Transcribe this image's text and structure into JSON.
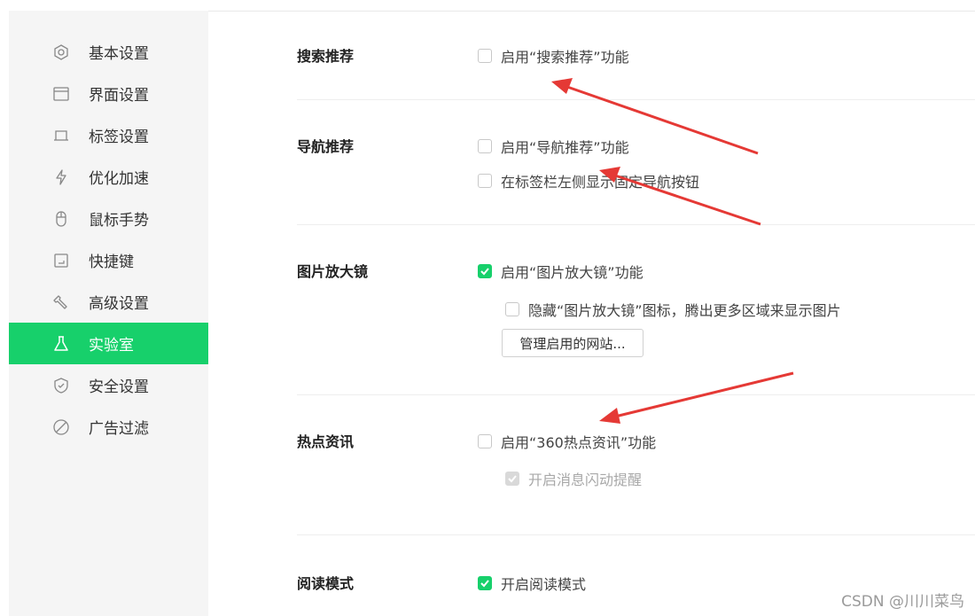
{
  "sidebar": {
    "items": [
      {
        "label": "基本设置",
        "icon": "hexagon-settings-icon",
        "active": false
      },
      {
        "label": "界面设置",
        "icon": "window-icon",
        "active": false
      },
      {
        "label": "标签设置",
        "icon": "tab-icon",
        "active": false
      },
      {
        "label": "优化加速",
        "icon": "lightning-icon",
        "active": false
      },
      {
        "label": "鼠标手势",
        "icon": "mouse-icon",
        "active": false
      },
      {
        "label": "快捷键",
        "icon": "keyboard-icon",
        "active": false
      },
      {
        "label": "高级设置",
        "icon": "wrench-icon",
        "active": false
      },
      {
        "label": "实验室",
        "icon": "flask-icon",
        "active": true
      },
      {
        "label": "安全设置",
        "icon": "shield-check-icon",
        "active": false
      },
      {
        "label": "广告过滤",
        "icon": "block-icon",
        "active": false
      }
    ]
  },
  "sections": {
    "search": {
      "title": "搜索推荐",
      "options": [
        {
          "label": "启用“搜索推荐”功能",
          "checked": false
        }
      ]
    },
    "nav": {
      "title": "导航推荐",
      "options": [
        {
          "label": "启用“导航推荐”功能",
          "checked": false
        },
        {
          "label": "在标签栏左侧显示固定导航按钮",
          "checked": false
        }
      ]
    },
    "magnifier": {
      "title": "图片放大镜",
      "options": [
        {
          "label": "启用“图片放大镜”功能",
          "checked": true
        },
        {
          "label": "隐藏“图片放大镜”图标，腾出更多区域来显示图片",
          "checked": false
        }
      ],
      "button_label": "管理启用的网站..."
    },
    "hotnews": {
      "title": "热点资讯",
      "options": [
        {
          "label": "启用“360热点资讯”功能",
          "checked": false
        },
        {
          "label": "开启消息闪动提醒",
          "checked": true,
          "disabled": true
        }
      ]
    },
    "reading": {
      "title": "阅读模式",
      "options": [
        {
          "label": "开启阅读模式",
          "checked": true
        }
      ]
    }
  },
  "colors": {
    "accent": "#17d06b",
    "sidebar_bg": "#f5f5f5",
    "annotation_arrow": "#e53935"
  },
  "watermark": "CSDN @川川菜鸟"
}
